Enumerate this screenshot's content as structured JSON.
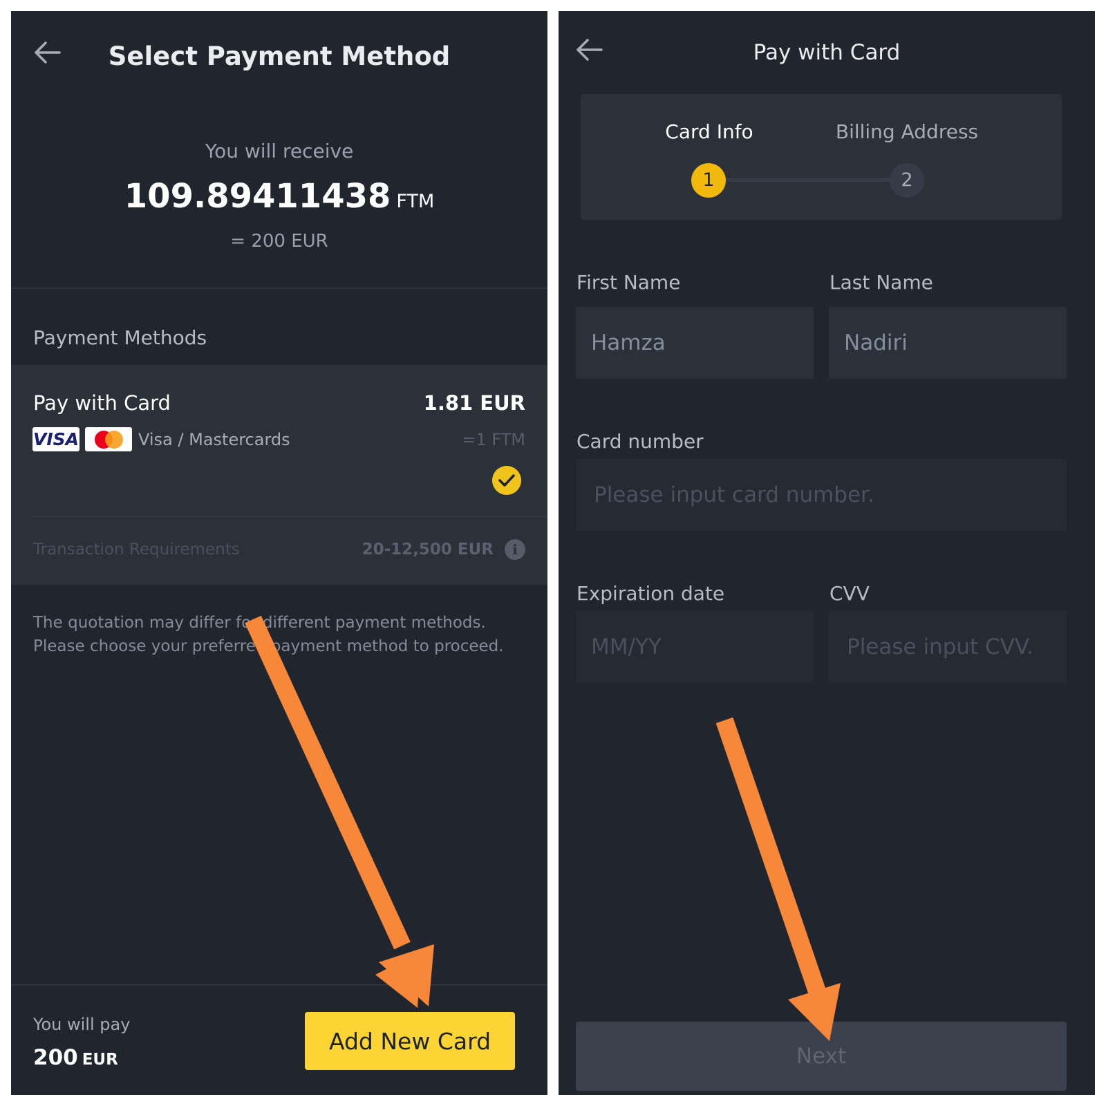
{
  "left": {
    "title": "Select Payment Method",
    "receive_label": "You will receive",
    "receive_amount": "109.89411438",
    "receive_unit": "FTM",
    "receive_eq": "= 200 EUR",
    "payment_methods_label": "Payment Methods",
    "method": {
      "name": "Pay with Card",
      "fee": "1.81 EUR",
      "visa": "VISA",
      "brands": "Visa / Mastercards",
      "fee_ftm": "=1 FTM",
      "selected": true,
      "requirements_label": "Transaction Requirements",
      "requirements_range": "20-12,500 EUR"
    },
    "note": "The quotation may differ for different payment methods. Please choose your preferred payment method to proceed.",
    "pay_label": "You will pay",
    "pay_amount": "200",
    "pay_unit": "EUR",
    "add_card_label": "Add New Card"
  },
  "right": {
    "title": "Pay with Card",
    "steps": [
      {
        "number": "1",
        "label": "Card Info",
        "active": true
      },
      {
        "number": "2",
        "label": "Billing Address",
        "active": false
      }
    ],
    "first_name_label": "First Name",
    "first_name_value": "Hamza",
    "last_name_label": "Last Name",
    "last_name_value": "Nadiri",
    "card_number_label": "Card number",
    "card_number_placeholder": "Please input card number.",
    "expiration_label": "Expiration date",
    "expiration_placeholder": "MM/YY",
    "cvv_label": "CVV",
    "cvv_placeholder": "Please input CVV.",
    "next_label": "Next"
  },
  "colors": {
    "background": "#20252e",
    "card_background": "#2b3039",
    "accent_yellow": "#fcd535",
    "annotation_arrow": "#f7883a",
    "text_primary": "#eaecef",
    "text_secondary": "#9aa1ad"
  },
  "icons": [
    "back-arrow-icon",
    "visa-logo",
    "mastercard-logo",
    "check-icon",
    "info-icon"
  ]
}
